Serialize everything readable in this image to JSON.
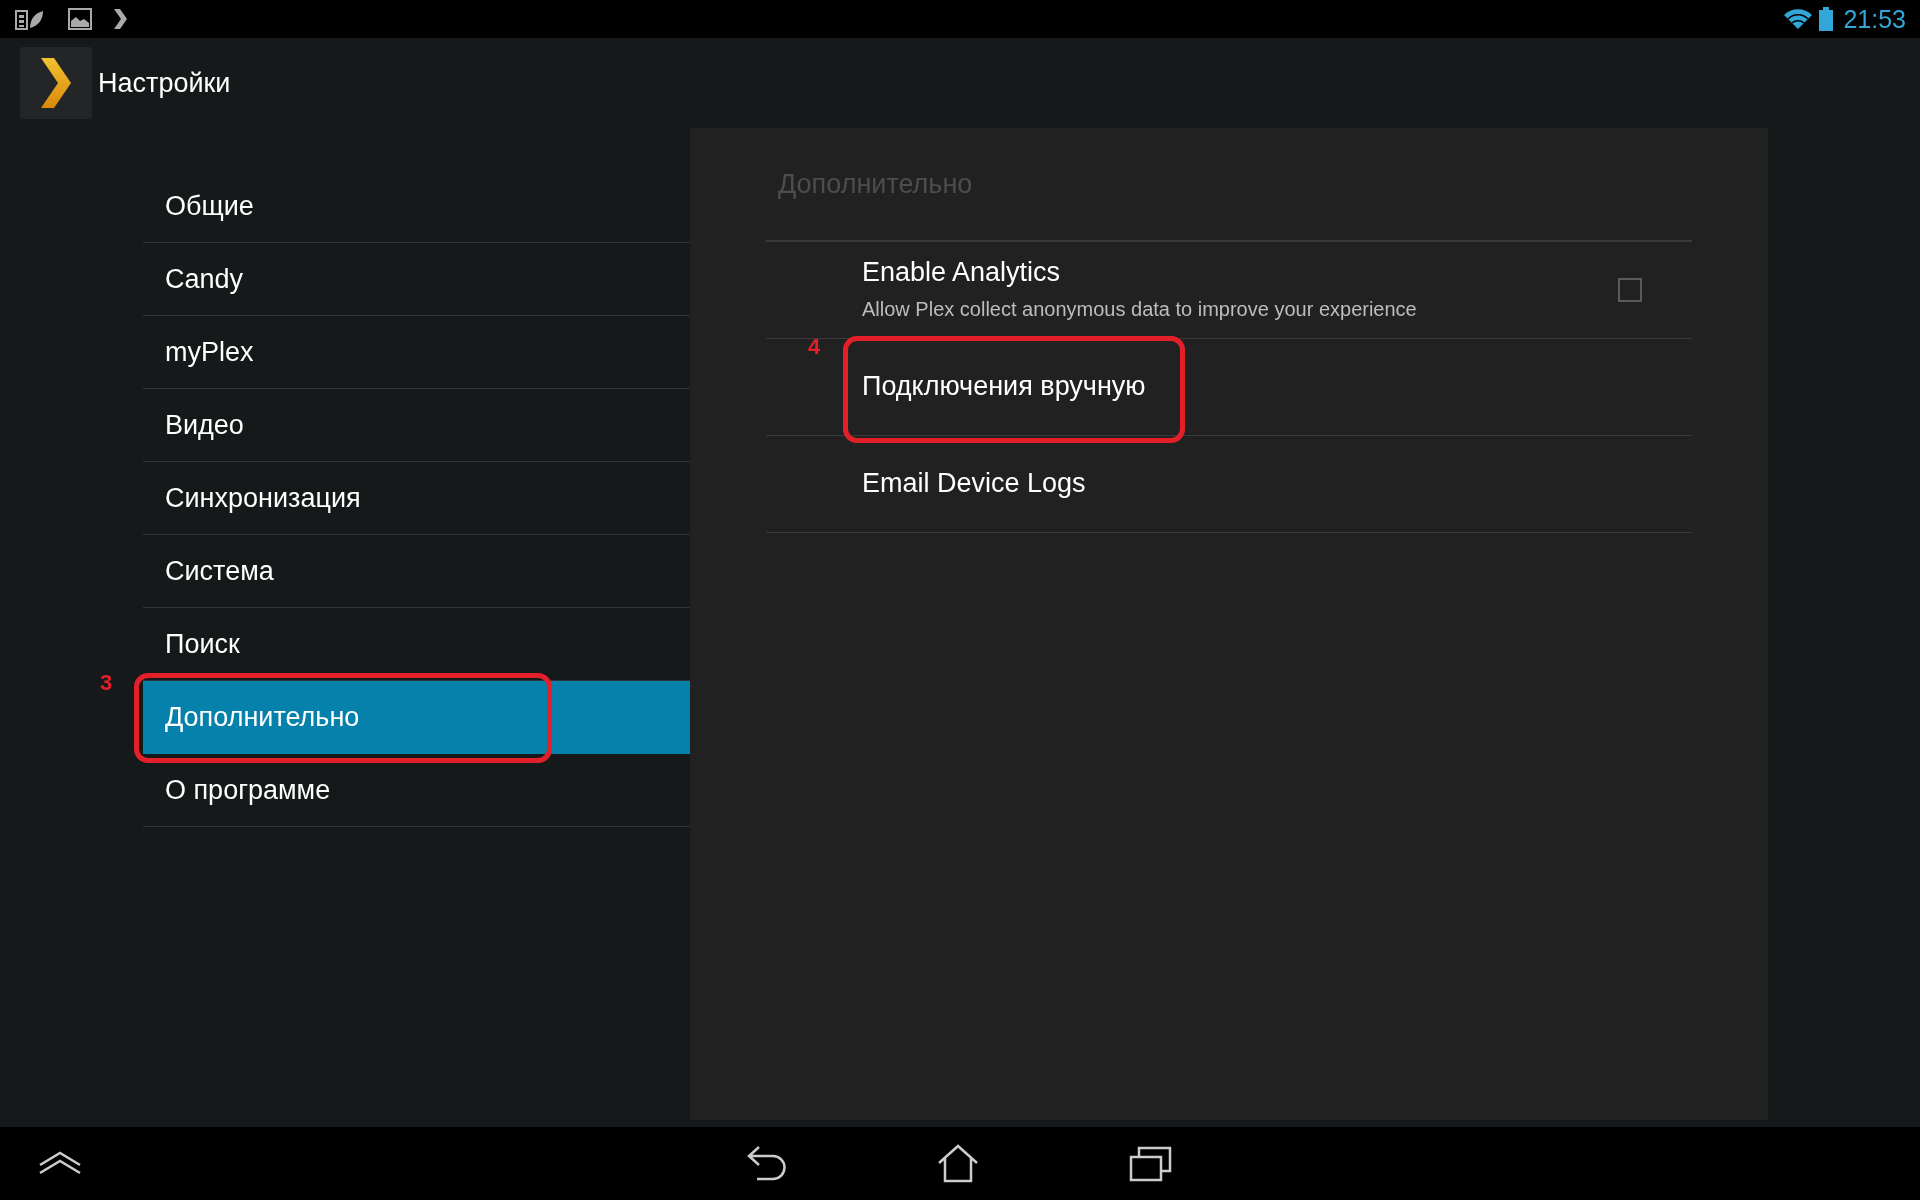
{
  "status_bar": {
    "time": "21:53"
  },
  "action_bar": {
    "title": "Настройки"
  },
  "sidebar": {
    "items": [
      {
        "label": "Общие",
        "selected": false
      },
      {
        "label": "Candy",
        "selected": false
      },
      {
        "label": "myPlex",
        "selected": false
      },
      {
        "label": "Видео",
        "selected": false
      },
      {
        "label": "Синхронизация",
        "selected": false
      },
      {
        "label": "Система",
        "selected": false
      },
      {
        "label": "Поиск",
        "selected": false
      },
      {
        "label": "Дополнительно",
        "selected": true,
        "annotation": "3"
      },
      {
        "label": "О программе",
        "selected": false
      }
    ]
  },
  "panel": {
    "header": "Дополнительно",
    "rows": [
      {
        "kind": "checkbox",
        "title": "Enable Analytics",
        "summary": "Allow Plex collect anonymous data to improve your experience",
        "checked": false
      },
      {
        "kind": "plain",
        "title": "Подключения вручную",
        "annotation": "4"
      },
      {
        "kind": "plain",
        "title": "Email Device Logs"
      }
    ]
  }
}
